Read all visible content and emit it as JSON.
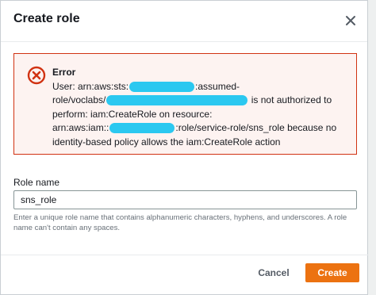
{
  "modal": {
    "title": "Create role",
    "close_icon": "close-icon"
  },
  "error": {
    "icon": "error-circle-x-icon",
    "title": "Error",
    "lines": [
      {
        "before": "User: arn:aws:sts:",
        "after": ":assumed-"
      },
      {
        "before": "role/voclabs/",
        "after": "is not authorized to"
      },
      {
        "text": "perform: iam:CreateRole on resource:"
      },
      {
        "before": "arn:aws:iam::",
        "after": ":role/service-role/sns_role because no"
      },
      {
        "text": "identity-based policy allows the iam:CreateRole action"
      }
    ],
    "redaction_color": "#2bc8f0"
  },
  "form": {
    "role_name_label": "Role name",
    "role_name_value": "sns_role",
    "hint": "Enter a unique role name that contains alphanumeric characters, hyphens, and underscores. A role name can't contain any spaces."
  },
  "footer": {
    "cancel_label": "Cancel",
    "create_label": "Create"
  },
  "colors": {
    "error_border": "#d13212",
    "primary_button": "#ec7211"
  }
}
